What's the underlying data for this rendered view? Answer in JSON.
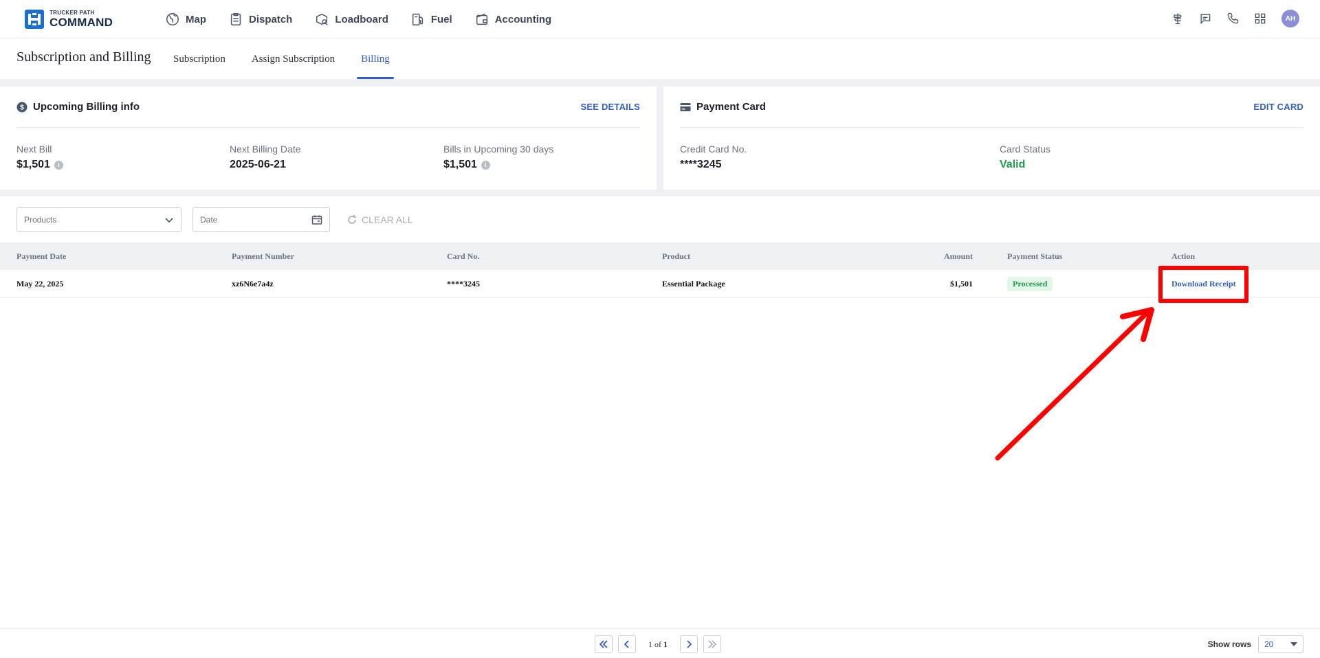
{
  "brand": {
    "small": "TRUCKER PATH",
    "big": "COMMAND",
    "color": "#1a6fd1"
  },
  "nav": {
    "links": [
      {
        "label": "Map",
        "icon": "map-icon"
      },
      {
        "label": "Dispatch",
        "icon": "clipboard-icon"
      },
      {
        "label": "Loadboard",
        "icon": "loadboard-icon"
      },
      {
        "label": "Fuel",
        "icon": "fuel-pump-icon"
      },
      {
        "label": "Accounting",
        "icon": "wallet-icon"
      }
    ],
    "right_icons": [
      "signpost-icon",
      "chat-icon",
      "phone-icon",
      "apps-grid-icon"
    ],
    "avatar": "AH"
  },
  "subheader": {
    "title": "Subscription and Billing",
    "tabs": [
      {
        "label": "Subscription",
        "active": false
      },
      {
        "label": "Assign Subscription",
        "active": false
      },
      {
        "label": "Billing",
        "active": true
      }
    ]
  },
  "billing_info": {
    "title": "Upcoming Billing info",
    "link": "SEE DETAILS",
    "next_bill_label": "Next Bill",
    "next_bill_value": "$1,501",
    "next_date_label": "Next Billing Date",
    "next_date_value": "2025-06-21",
    "upcoming_label": "Bills in Upcoming 30 days",
    "upcoming_value": "$1,501"
  },
  "payment_card": {
    "title": "Payment Card",
    "link": "EDIT CARD",
    "card_no_label": "Credit Card No.",
    "card_no_value": "****3245",
    "status_label": "Card Status",
    "status_value": "Valid"
  },
  "filters": {
    "products_placeholder": "Products",
    "date_placeholder": "Date",
    "clear_all": "CLEAR ALL"
  },
  "table": {
    "headers": [
      "Payment Date",
      "Payment Number",
      "Card No.",
      "Product",
      "Amount",
      "Payment Status",
      "Action"
    ],
    "rows": [
      {
        "date": "May 22, 2025",
        "number": "xz6N6e7a4z",
        "card": "****3245",
        "product": "Essential Package",
        "amount": "$1,501",
        "status": "Processed",
        "action": "Download Receipt"
      }
    ]
  },
  "pagination": {
    "current": "1",
    "of": "of",
    "total": "1",
    "show_rows_label": "Show rows",
    "rows_value": "20"
  },
  "colors": {
    "accent": "#2f5cc8",
    "valid": "#1e9e4a",
    "annotation": "#ff0000"
  }
}
